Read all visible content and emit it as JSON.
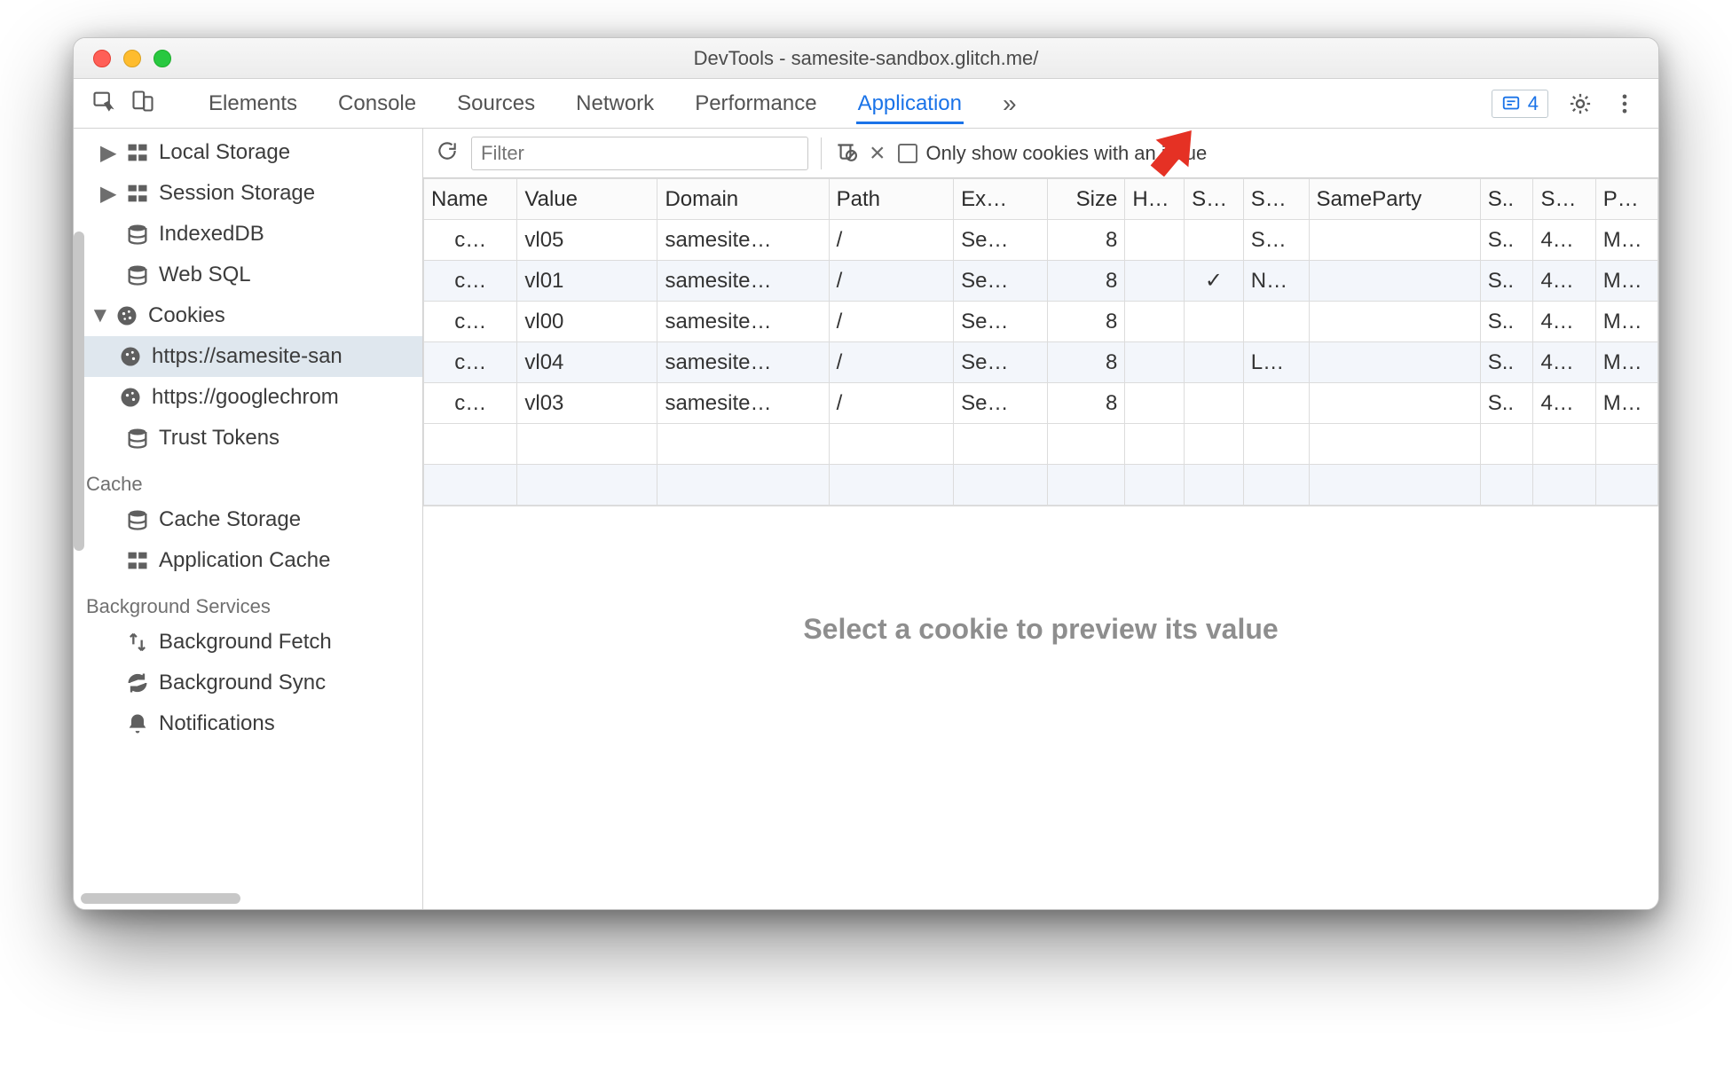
{
  "window_title": "DevTools - samesite-sandbox.glitch.me/",
  "tabs": [
    "Elements",
    "Console",
    "Sources",
    "Network",
    "Performance",
    "Application"
  ],
  "active_tab": "Application",
  "issue_count": "4",
  "filter": {
    "placeholder": "Filter"
  },
  "only_issues_label": "Only show cookies with an issue",
  "sidebar": {
    "items": [
      {
        "label": "Local Storage",
        "icon": "grid"
      },
      {
        "label": "Session Storage",
        "icon": "grid"
      },
      {
        "label": "IndexedDB",
        "icon": "db"
      },
      {
        "label": "Web SQL",
        "icon": "db"
      }
    ],
    "cookies_label": "Cookies",
    "cookie_origins": [
      "https://samesite-san",
      "https://googlechrom"
    ],
    "trust_tokens": "Trust Tokens",
    "cache_section": "Cache",
    "cache_items": [
      "Cache Storage",
      "Application Cache"
    ],
    "bg_section": "Background Services",
    "bg_items": [
      "Background Fetch",
      "Background Sync",
      "Notifications"
    ]
  },
  "columns": [
    "Name",
    "Value",
    "Domain",
    "Path",
    "Ex…",
    "Size",
    "H…",
    "S…",
    "S…",
    "SameParty",
    "S..",
    "S…",
    "P…"
  ],
  "rows": [
    {
      "name": "c…",
      "value": "vl05",
      "domain": "samesite…",
      "path": "/",
      "exp": "Se…",
      "size": "8",
      "h": "",
      "sec": "",
      "ss": "S…",
      "sp": "",
      "x1": "S..",
      "x2": "4…",
      "pr": "M…"
    },
    {
      "name": "c…",
      "value": "vl01",
      "domain": "samesite…",
      "path": "/",
      "exp": "Se…",
      "size": "8",
      "h": "",
      "sec": "✓",
      "ss": "N…",
      "sp": "",
      "x1": "S..",
      "x2": "4…",
      "pr": "M…"
    },
    {
      "name": "c…",
      "value": "vl00",
      "domain": "samesite…",
      "path": "/",
      "exp": "Se…",
      "size": "8",
      "h": "",
      "sec": "",
      "ss": "",
      "sp": "",
      "x1": "S..",
      "x2": "4…",
      "pr": "M…"
    },
    {
      "name": "c…",
      "value": "vl04",
      "domain": "samesite…",
      "path": "/",
      "exp": "Se…",
      "size": "8",
      "h": "",
      "sec": "",
      "ss": "L…",
      "sp": "",
      "x1": "S..",
      "x2": "4…",
      "pr": "M…"
    },
    {
      "name": "c…",
      "value": "vl03",
      "domain": "samesite…",
      "path": "/",
      "exp": "Se…",
      "size": "8",
      "h": "",
      "sec": "",
      "ss": "",
      "sp": "",
      "x1": "S..",
      "x2": "4…",
      "pr": "M…"
    }
  ],
  "preview_text": "Select a cookie to preview its value"
}
